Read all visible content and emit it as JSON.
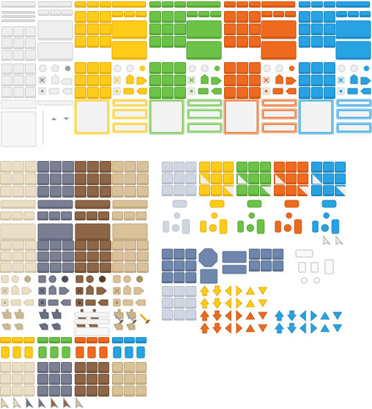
{
  "sheet": {
    "name": "ui-sprite-sheet",
    "background": "#ffffff"
  },
  "palettes": {
    "white": {
      "fill": "#eeeeee",
      "edge": "#cfcfcf",
      "dark": "#bdbdbd",
      "icon": "#9e9e9e"
    },
    "yellow": {
      "fill": "#ffcc1a",
      "edge": "#e6a800",
      "dark": "#d19500",
      "icon": "#ffcc1a"
    },
    "green": {
      "fill": "#6cc348",
      "edge": "#4e9f2e",
      "dark": "#3f8a23",
      "icon": "#6cc348"
    },
    "orange": {
      "fill": "#ee6a1e",
      "edge": "#c9520e",
      "dark": "#b3480b",
      "icon": "#ee6a1e"
    },
    "blue": {
      "fill": "#27a3e4",
      "edge": "#1a84c0",
      "dark": "#156fa3",
      "icon": "#27a3e4"
    },
    "beige": {
      "fill": "#eadfc6",
      "edge": "#d2c3a2",
      "dark": "#bfae8b",
      "icon": "#cbb994"
    },
    "grey": {
      "fill": "#7a7f94",
      "edge": "#5f6377",
      "dark": "#4d5063",
      "icon": "#6a6f84"
    },
    "brown": {
      "fill": "#8d6547",
      "edge": "#6e4c32",
      "dark": "#5b3d27",
      "icon": "#8d6547"
    },
    "tan": {
      "fill": "#d9c19a",
      "edge": "#bfa57b",
      "dark": "#a98f67",
      "icon": "#cfb48a"
    },
    "slate": {
      "fill": "#6f87ad",
      "edge": "#56698a",
      "dark": "#44557a",
      "icon": "#6f87ad"
    },
    "paleBlue": {
      "fill": "#cfd6e2",
      "edge": "#b5bdcc",
      "dark": "#9aa3b5",
      "icon": "#cfd6e2"
    }
  },
  "icon_names": [
    "check-box-icon",
    "radio-icon",
    "close-icon",
    "shield-icon",
    "arrow-tab-icon",
    "cursor-icon",
    "hand-pointer-icon",
    "sword-icon",
    "arrow-icon"
  ]
}
